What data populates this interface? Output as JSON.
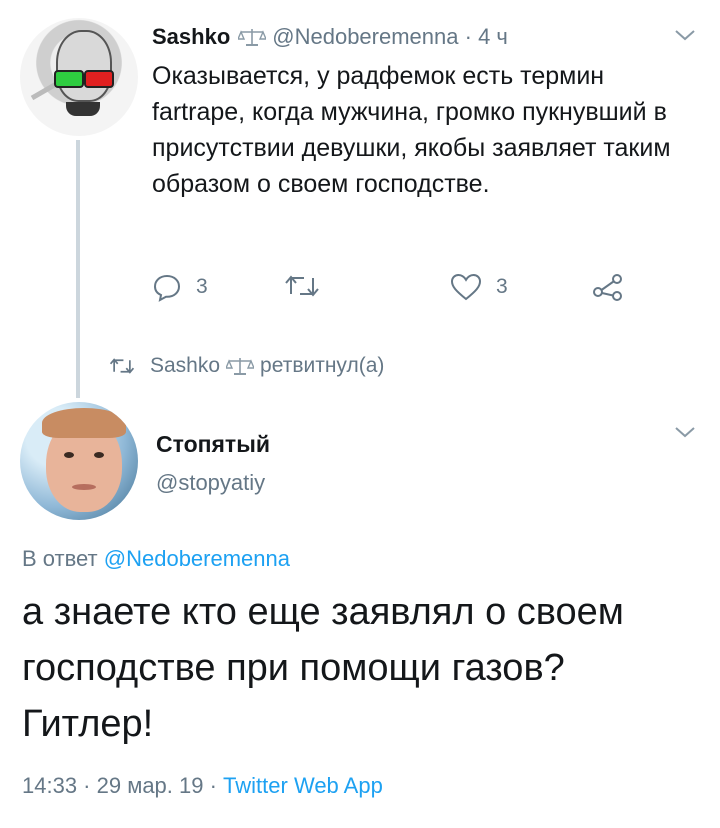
{
  "tweet": {
    "author_name": "Sashko",
    "author_handle": "@Nedoberemenna",
    "separator": "·",
    "time": "4 ч",
    "text": "Оказывается, у радфемок есть термин fartrape, когда мужчина, громко пукнувший в присутствии девушки, якобы заявляет таким образом о своем господстве.",
    "actions": {
      "reply_count": "3",
      "retweet_count": "",
      "like_count": "3"
    }
  },
  "retweet_notice": {
    "user": "Sashko",
    "label": "ретвитнул(а)"
  },
  "reply": {
    "author_name": "Стопятый",
    "author_handle": "@stopyatiy",
    "reply_to_prefix": "В ответ",
    "reply_to_handle": "@Nedoberemenna",
    "text": "а знаете кто еще заявлял о своем господстве при помощи газов? Гитлер!",
    "timestamp": "14:33 · 29 мар. 19 ·",
    "source": "Twitter Web App"
  },
  "colors": {
    "link": "#1da1f2",
    "muted": "#657786",
    "text": "#14171a",
    "thread_line": "#ccd6dd"
  },
  "icons": [
    "scale-icon",
    "chevron-down-icon",
    "reply-icon",
    "retweet-icon",
    "like-icon",
    "share-icon"
  ]
}
